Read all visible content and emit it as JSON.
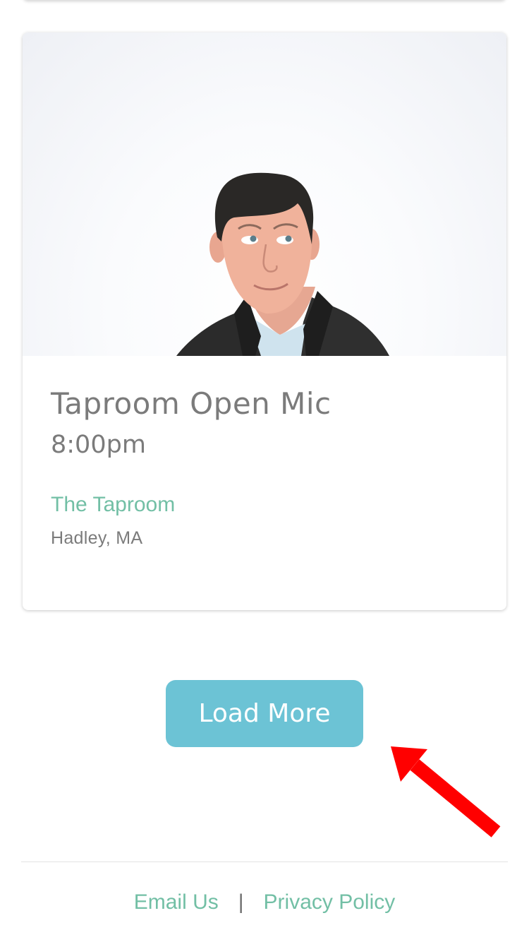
{
  "event": {
    "title": "Taproom Open Mic",
    "time": "8:00pm",
    "venue": "The Taproom",
    "location": "Hadley, MA"
  },
  "load_more_label": "Load More",
  "footer": {
    "email_label": "Email Us",
    "separator": "|",
    "privacy_label": "Privacy Policy"
  },
  "colors": {
    "accent_green": "#72bfa5",
    "button_blue": "#6cc3d5",
    "text_gray": "#7b7b7b",
    "arrow_red": "#ff0000"
  },
  "icons": {
    "annotation": "red-arrow-icon"
  }
}
